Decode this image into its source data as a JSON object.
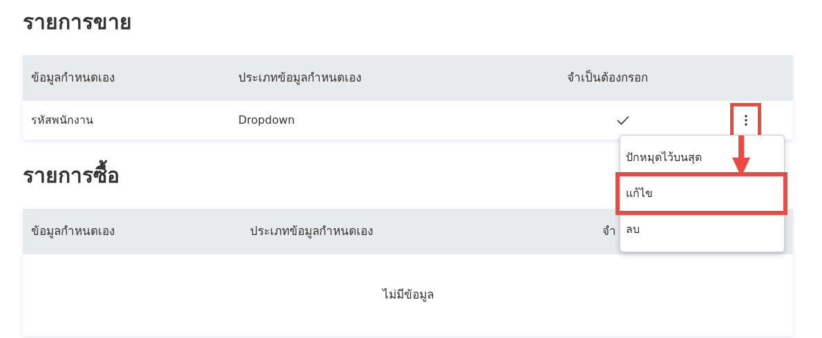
{
  "sections": [
    {
      "title": "รายการขาย",
      "columns": [
        "ข้อมูลกำหนดเอง",
        "ประเภทข้อมูลกำหนดเอง",
        "จำเป็นต้องกรอก"
      ],
      "rows": [
        {
          "name": "รหัสพนักงาน",
          "type": "Dropdown",
          "required": true,
          "menu_button_highlighted": true
        }
      ]
    },
    {
      "title": "รายการซื้อ",
      "columns": [
        "ข้อมูลกำหนดเอง",
        "ประเภทข้อมูลกำหนดเอง",
        "จำ"
      ],
      "empty_text": "ไม่มีข้อมูล"
    }
  ],
  "context_menu": {
    "items": [
      {
        "label": "ปักหมุดไว้บนสุด",
        "highlighted": false
      },
      {
        "label": "แก้ไข",
        "highlighted": true
      },
      {
        "label": "ลบ",
        "highlighted": false
      }
    ]
  }
}
